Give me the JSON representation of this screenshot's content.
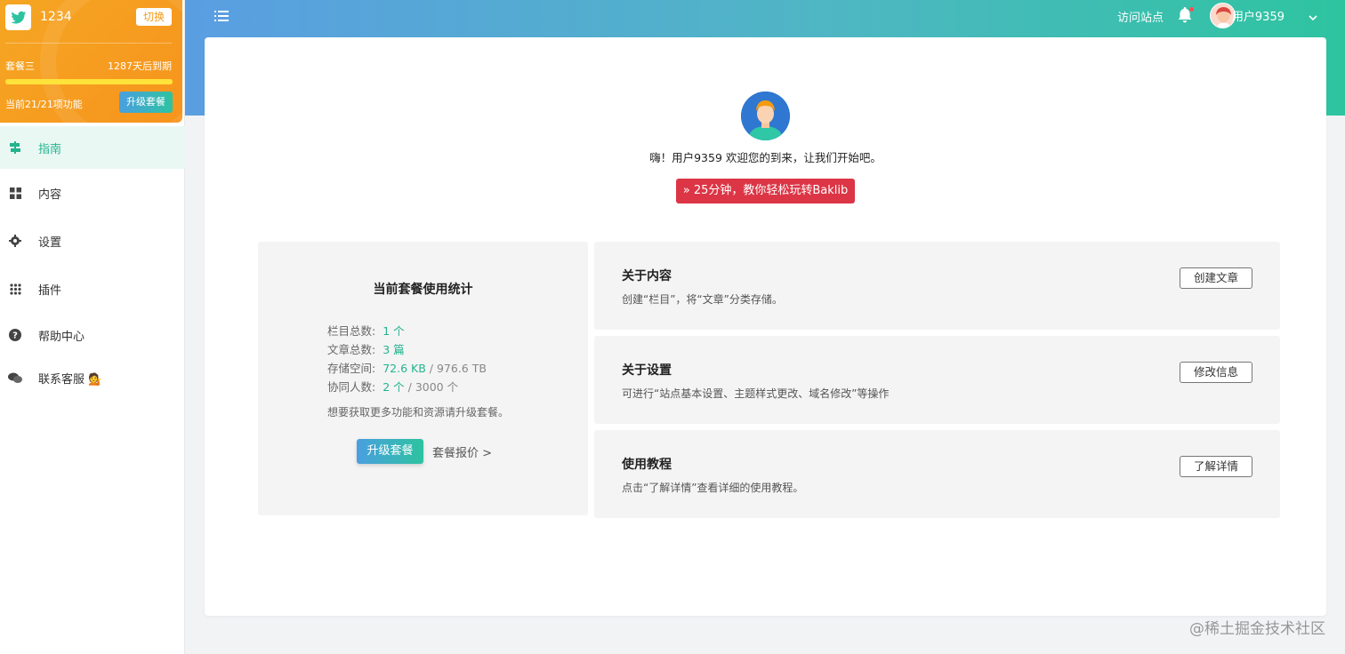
{
  "brand": {
    "name": "1234",
    "switch_label": "切换"
  },
  "plan": {
    "name": "套餐三",
    "expire": "1287天后到期",
    "progress_fraction": 1.0,
    "features": "当前21/21项功能",
    "upgrade_label": "升级套餐"
  },
  "sidebar": {
    "items": [
      {
        "label": "指南",
        "icon": "signpost-icon",
        "active": true
      },
      {
        "label": "内容",
        "icon": "grid-icon"
      },
      {
        "label": "设置",
        "icon": "gear-icon"
      },
      {
        "label": "插件",
        "icon": "dots-grid-icon"
      },
      {
        "label": "帮助中心",
        "icon": "question-circle-icon"
      },
      {
        "label": "联系客服 💁",
        "icon": "chat-bubbles-icon"
      }
    ]
  },
  "header": {
    "visit_site": "访问站点",
    "user_name": "用户9359"
  },
  "hero": {
    "welcome": "嗨！用户9359 欢迎您的到来，让我们开始吧。",
    "tutorial_button": "» 25分钟，教你轻松玩转Baklib"
  },
  "stats": {
    "title": "当前套餐使用统计",
    "rows": [
      {
        "label": "栏目总数:",
        "value": "1 个",
        "limit": ""
      },
      {
        "label": "文章总数:",
        "value": "3 篇",
        "limit": ""
      },
      {
        "label": "存储空间:",
        "value": "72.6 KB",
        "limit": "/ 976.6 TB"
      },
      {
        "label": "协同人数:",
        "value": "2 个",
        "limit": "/ 3000 个"
      }
    ],
    "tip": "想要获取更多功能和资源请升级套餐。",
    "upgrade_label": "升级套餐",
    "pricing_label": "套餐报价 >"
  },
  "panels": [
    {
      "title": "关于内容",
      "desc": "创建“栏目”，将“文章”分类存储。",
      "button": "创建文章"
    },
    {
      "title": "关于设置",
      "desc": "可进行“站点基本设置、主题样式更改、域名修改”等操作",
      "button": "修改信息"
    },
    {
      "title": "使用教程",
      "desc": "点击“了解详情”查看详细的使用教程。",
      "button": "了解详情"
    }
  ],
  "watermark": "@稀土掘金技术社区",
  "colors": {
    "accent": "#23b38d",
    "plan_orange": "#f7941d",
    "danger": "#dc3545"
  }
}
